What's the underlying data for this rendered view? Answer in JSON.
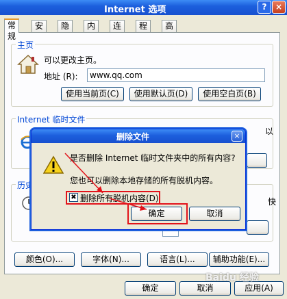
{
  "window": {
    "title": "Internet 选项",
    "help_label": "?",
    "close_label": "×"
  },
  "tabs": [
    "常规",
    "安全",
    "隐私",
    "内容",
    "连接",
    "程序",
    "高级"
  ],
  "homepage": {
    "legend": "主页",
    "desc": "可以更改主页。",
    "address_label": "地址 (R):",
    "address_value": "www.qq.com",
    "buttons": [
      "使用当前页(C)",
      "使用默认页(D)",
      "使用空白页(B)"
    ]
  },
  "temp_files": {
    "legend": "Internet 临时文件",
    "partial_right": "以"
  },
  "history": {
    "legend": "历史",
    "partial_left": "网",
    "partial_right": "快"
  },
  "bottom_buttons": [
    "颜色(O)...",
    "字体(N)...",
    "语言(L)...",
    "辅助功能(E)..."
  ],
  "footer_buttons": [
    "确定",
    "取消",
    "应用(A)"
  ],
  "dialog": {
    "title": "删除文件",
    "close_label": "×",
    "question": "是否删除 Internet 临时文件夹中的所有内容?",
    "info": "您也可以删除本地存储的所有脱机内容。",
    "checkbox_label": "删除所有脱机内容(D)",
    "checkbox_checked": true,
    "ok_label": "确定",
    "cancel_label": "取消"
  },
  "watermark": "Baidu 经验",
  "colors": {
    "highlight_red": "#e2131a",
    "title_blue": "#1c5fdd"
  }
}
